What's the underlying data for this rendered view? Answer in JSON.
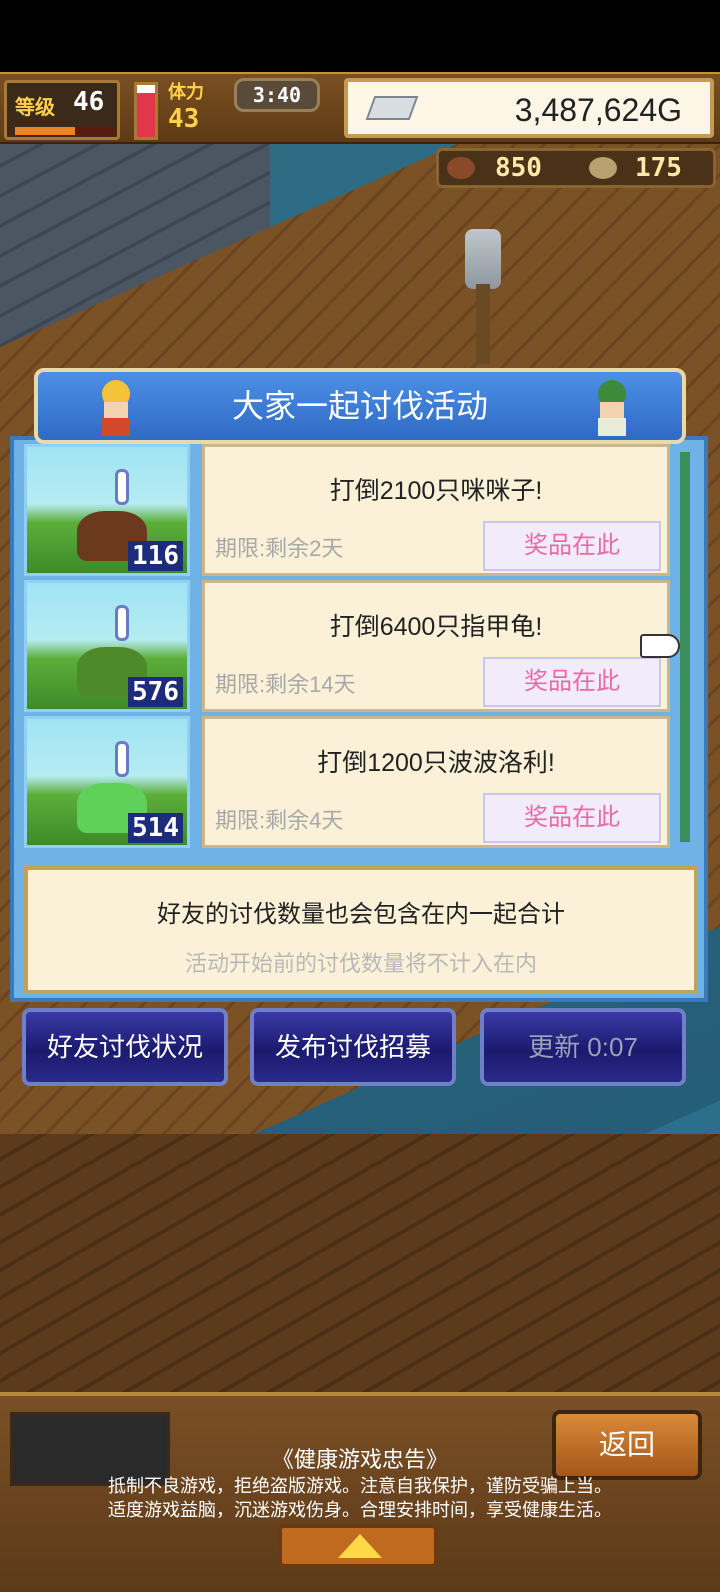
{
  "hud": {
    "level_label": "等级",
    "level_value": "46",
    "level_progress": 0.6,
    "stamina_label": "体力",
    "stamina_value": "43",
    "stamina_fill": 0.85,
    "timer": "3:40",
    "gold": "3,487,624G",
    "resource1_icon": "meat-icon",
    "resource1_value": "850",
    "resource2_icon": "medal-icon",
    "resource2_value": "175"
  },
  "panel": {
    "title": "大家一起讨伐活动",
    "events": [
      {
        "title": "打倒2100只咪咪子!",
        "deadline": "期限:剩余2天",
        "prize_label": "奖品在此",
        "count": "116",
        "monster_color": "#6b3a1e"
      },
      {
        "title": "打倒6400只指甲龟!",
        "deadline": "期限:剩余14天",
        "prize_label": "奖品在此",
        "count": "576",
        "monster_color": "#4f8a2a"
      },
      {
        "title": "打倒1200只波波洛利!",
        "deadline": "期限:剩余4天",
        "prize_label": "奖品在此",
        "count": "514",
        "monster_color": "#5fd05a"
      }
    ],
    "note_main": "好友的讨伐数量也会包含在内一起合计",
    "note_sub": "活动开始前的讨伐数量将不计入在内"
  },
  "buttons": {
    "friends_status": "好友讨伐状况",
    "post_recruit": "发布讨伐招募",
    "refresh": "更新 0:07"
  },
  "footer": {
    "back": "返回",
    "health_title": "《健康游戏忠告》",
    "health_line1": "抵制不良游戏，拒绝盗版游戏。注意自我保护，谨防受骗上当。",
    "health_line2": "适度游戏益脑，沉迷游戏伤身。合理安排时间，享受健康生活。"
  },
  "colors": {
    "panel_blue": "#6fb3e6",
    "title_blue": "#2f6ac4",
    "prize_pink": "#e66aa8",
    "button_navy": "#1a1a6e"
  }
}
